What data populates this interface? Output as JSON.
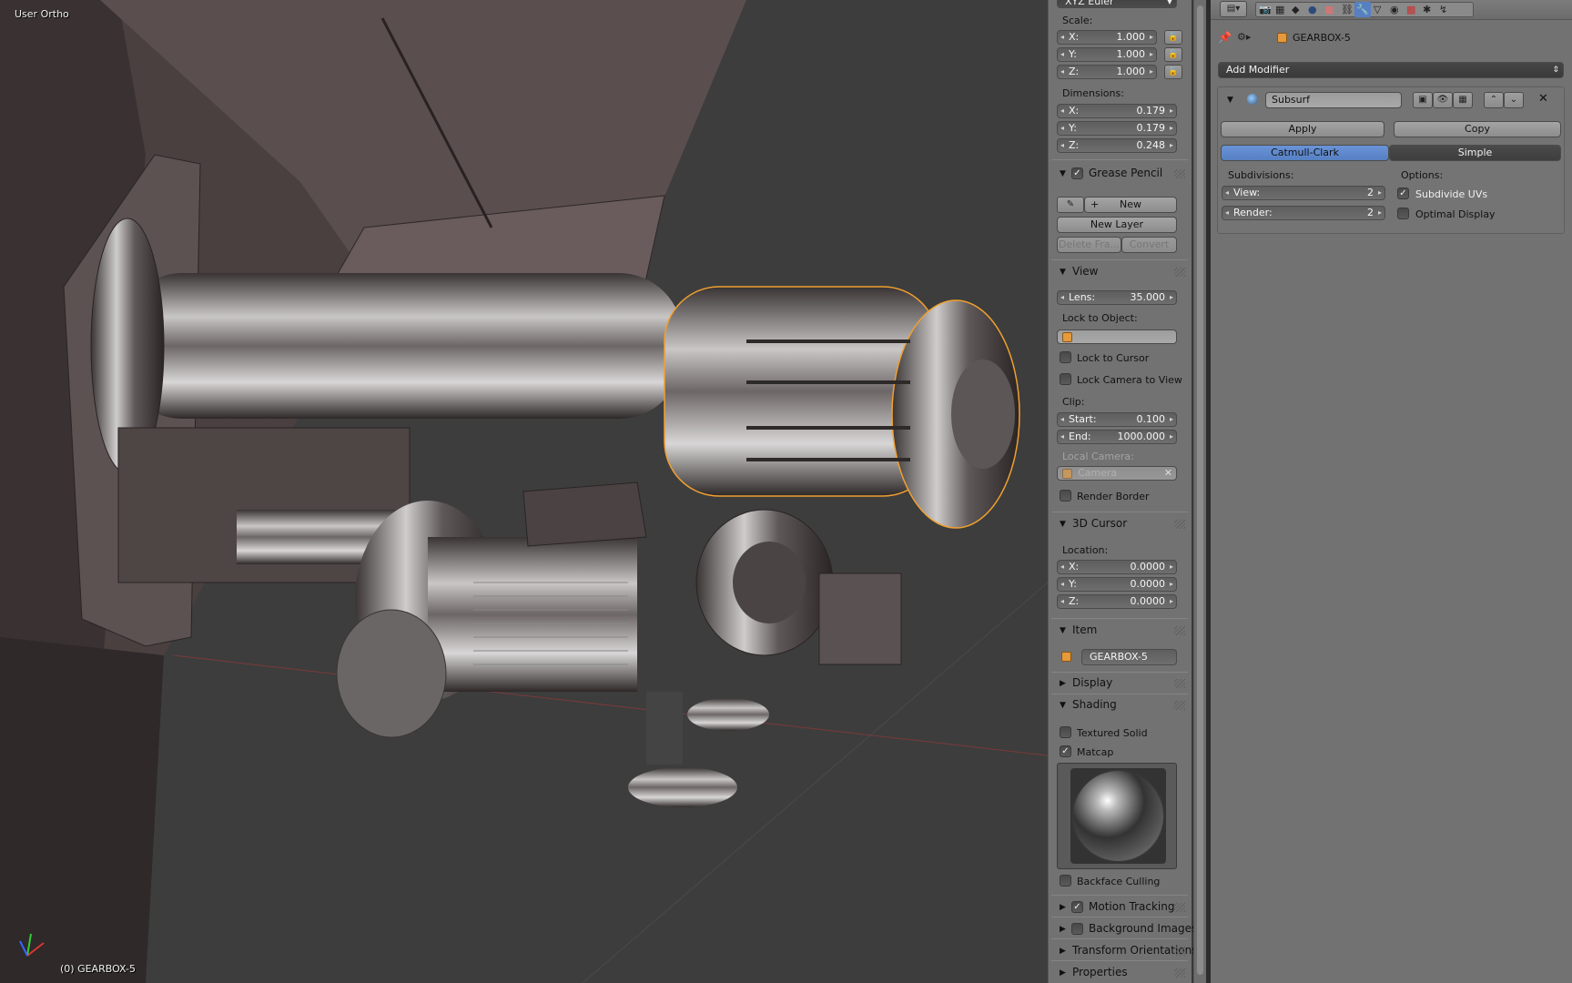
{
  "viewport": {
    "view_label": "User Ortho",
    "object_label": "(0) GEARBOX-5"
  },
  "npanel": {
    "rotation_mode": "XYZ Euler",
    "scale": {
      "label": "Scale:",
      "x": {
        "label": "X:",
        "value": "1.000"
      },
      "y": {
        "label": "Y:",
        "value": "1.000"
      },
      "z": {
        "label": "Z:",
        "value": "1.000"
      }
    },
    "dimensions": {
      "label": "Dimensions:",
      "x": {
        "label": "X:",
        "value": "0.179"
      },
      "y": {
        "label": "Y:",
        "value": "0.179"
      },
      "z": {
        "label": "Z:",
        "value": "0.248"
      }
    },
    "grease_pencil": {
      "title": "Grease Pencil",
      "new_label": "New",
      "new_layer_label": "New Layer",
      "delete_frame_label": "Delete Fra...",
      "convert_label": "Convert"
    },
    "view": {
      "title": "View",
      "lens_label": "Lens:",
      "lens_value": "35.000",
      "lock_to_object_label": "Lock to Object:",
      "lock_to_cursor_label": "Lock to Cursor",
      "lock_camera_label": "Lock Camera to View",
      "clip_label": "Clip:",
      "clip_start_label": "Start:",
      "clip_start_value": "0.100",
      "clip_end_label": "End:",
      "clip_end_value": "1000.000",
      "local_camera_label": "Local Camera:",
      "camera_value": "Camera",
      "render_border_label": "Render Border"
    },
    "cursor": {
      "title": "3D Cursor",
      "location_label": "Location:",
      "x": {
        "label": "X:",
        "value": "0.0000"
      },
      "y": {
        "label": "Y:",
        "value": "0.0000"
      },
      "z": {
        "label": "Z:",
        "value": "0.0000"
      }
    },
    "item": {
      "title": "Item",
      "name": "GEARBOX-5"
    },
    "display": {
      "title": "Display"
    },
    "shading": {
      "title": "Shading",
      "textured_solid_label": "Textured Solid",
      "matcap_label": "Matcap",
      "backface_culling_label": "Backface Culling"
    },
    "motion_tracking": {
      "title": "Motion Tracking"
    },
    "background_images": {
      "title": "Background Images"
    },
    "transform_orientations": {
      "title": "Transform Orientations"
    },
    "properties": {
      "title": "Properties"
    }
  },
  "props": {
    "object_name": "GEARBOX-5",
    "add_modifier_label": "Add Modifier",
    "modifier": {
      "name": "Subsurf",
      "apply_label": "Apply",
      "copy_label": "Copy",
      "catmull_label": "Catmull-Clark",
      "simple_label": "Simple",
      "subdivisions_label": "Subdivisions:",
      "view_label": "View:",
      "view_value": "2",
      "render_label": "Render:",
      "render_value": "2",
      "options_label": "Options:",
      "subdivide_uvs_label": "Subdivide UVs",
      "optimal_display_label": "Optimal Display"
    }
  },
  "colors": {
    "accent": "#5680c2",
    "selection": "#f0a030"
  }
}
